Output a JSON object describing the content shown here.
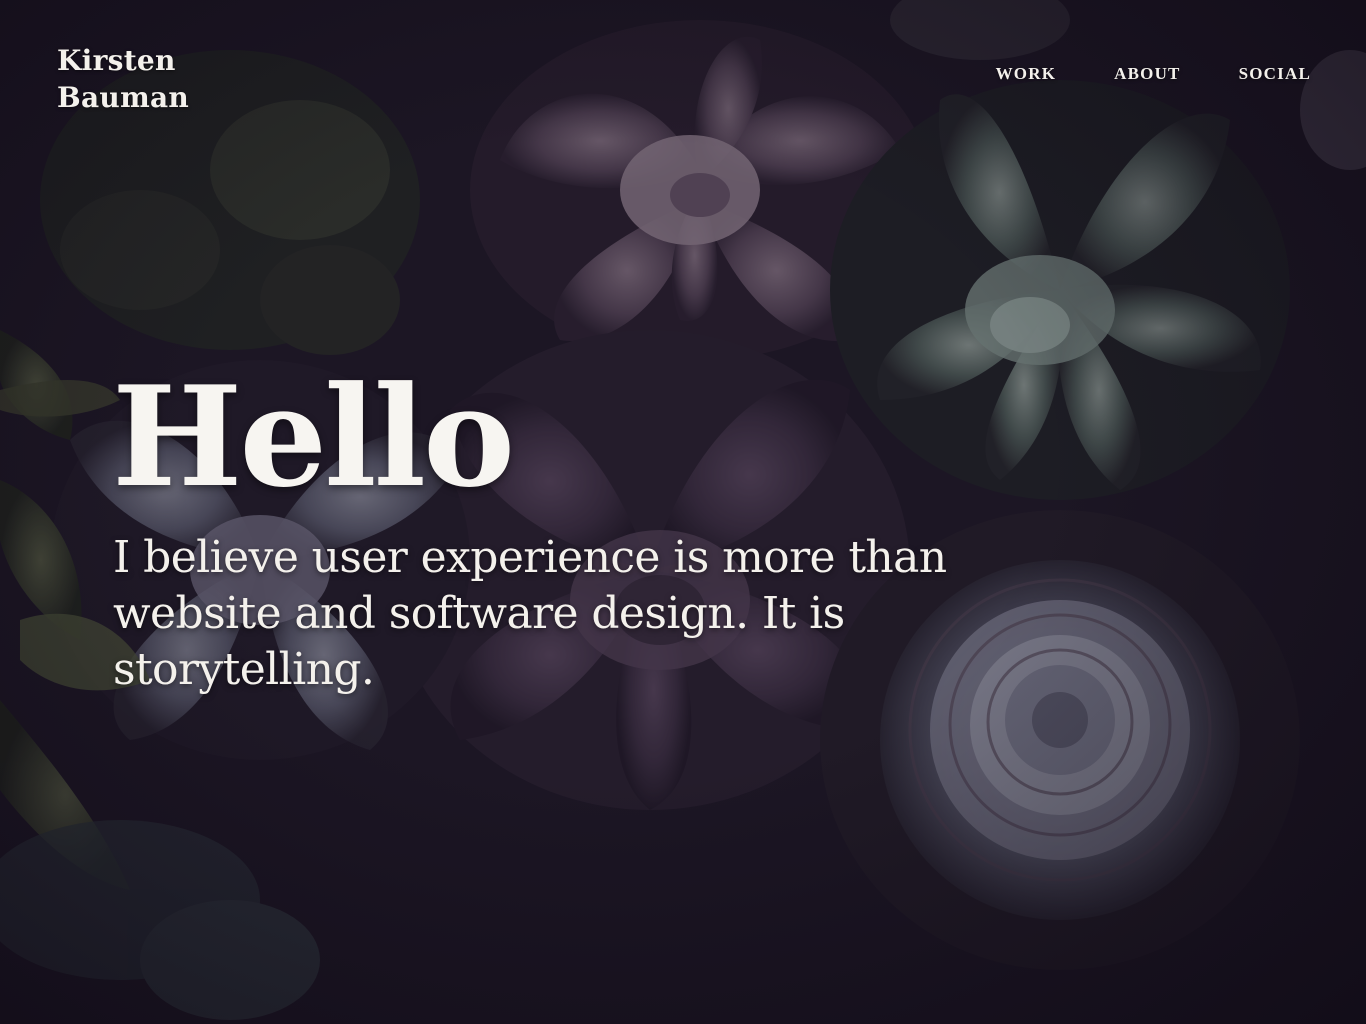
{
  "site": {
    "brand_line1": "Kirsten",
    "brand_line2": "Bauman"
  },
  "nav": {
    "items": [
      {
        "label": "WORK"
      },
      {
        "label": "ABOUT"
      },
      {
        "label": "SOCIAL"
      }
    ]
  },
  "hero": {
    "title": "Hello",
    "text": "I believe user experience is more than website and software design. It is storytelling."
  },
  "colors": {
    "background": "#1e1726",
    "text": "#f4f1ec"
  },
  "background_image": {
    "icon": "succulent-plants-photo"
  }
}
